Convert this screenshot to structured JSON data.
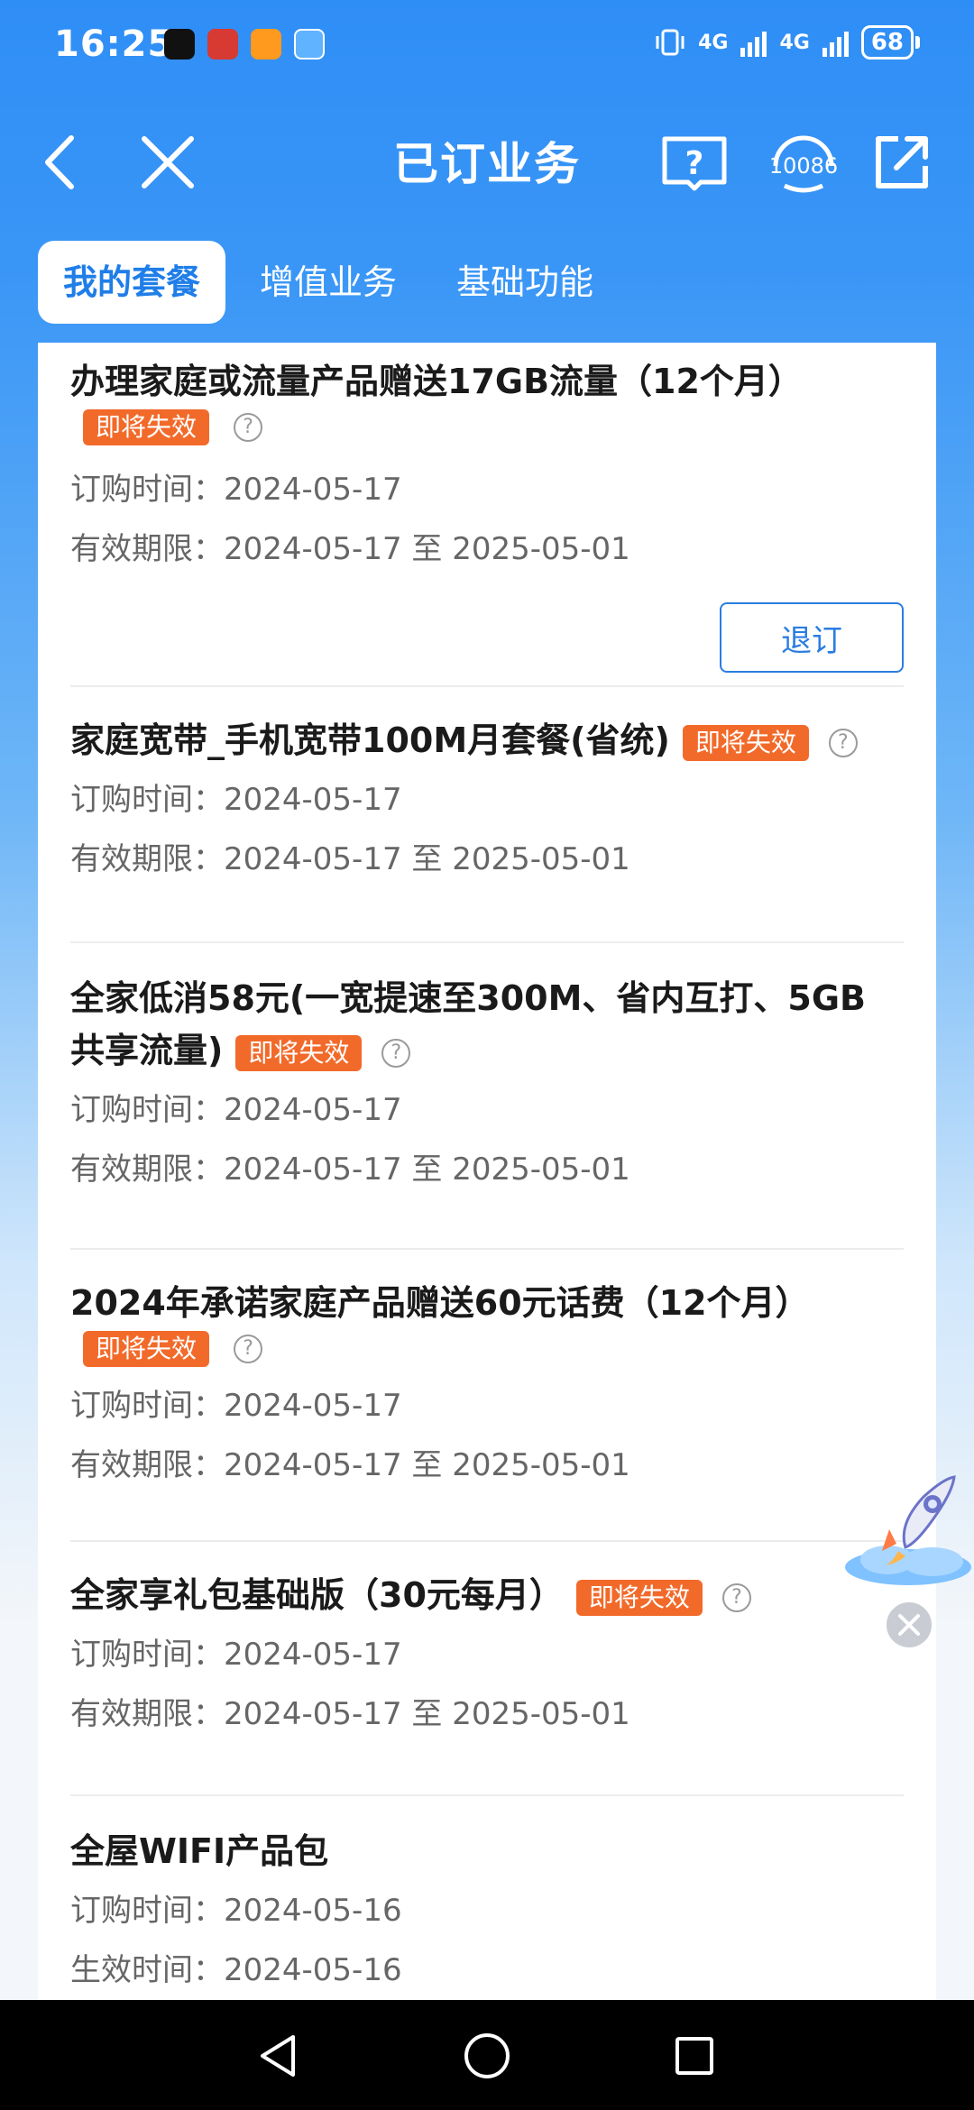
{
  "status_bar": {
    "time": "16:25",
    "network1": "4G",
    "network2": "4G",
    "battery": "68"
  },
  "header": {
    "title": "已订业务",
    "service_number": "10086"
  },
  "tabs": [
    {
      "label": "我的套餐",
      "active": true
    },
    {
      "label": "增值业务",
      "active": false
    },
    {
      "label": "基础功能",
      "active": false
    }
  ],
  "badge_text": "即将失效",
  "labels": {
    "order_time": "订购时间：",
    "valid_period": "有效期限：",
    "effective_time": "生效时间：",
    "to": " 至 "
  },
  "items": [
    {
      "title": "办理家庭或流量产品赠送17GB流量（12个月）",
      "order_time": "2024-05-17",
      "valid_from": "2024-05-17",
      "valid_to": "2025-05-01",
      "action": "退订"
    },
    {
      "title": "家庭宽带_手机宽带100M月套餐(省统)",
      "order_time": "2024-05-17",
      "valid_from": "2024-05-17",
      "valid_to": "2025-05-01"
    },
    {
      "title_line1": "全家低消58元(一宽提速至300M、省内互打、5GB",
      "title_line2": "共享流量)",
      "order_time": "2024-05-17",
      "valid_from": "2024-05-17",
      "valid_to": "2025-05-01"
    },
    {
      "title": "2024年承诺家庭产品赠送60元话费（12个月）",
      "order_time": "2024-05-17",
      "valid_from": "2024-05-17",
      "valid_to": "2025-05-01"
    },
    {
      "title": "全家享礼包基础版（30元每月）",
      "order_time": "2024-05-17",
      "valid_from": "2024-05-17",
      "valid_to": "2025-05-01"
    },
    {
      "title": "全屋WIFI产品包",
      "order_time": "2024-05-16",
      "effective_time": "2024-05-16"
    }
  ],
  "colors": {
    "accent": "#1f7ee8",
    "badge": "#f26a2a",
    "header_bg": "#2f8ef6"
  }
}
